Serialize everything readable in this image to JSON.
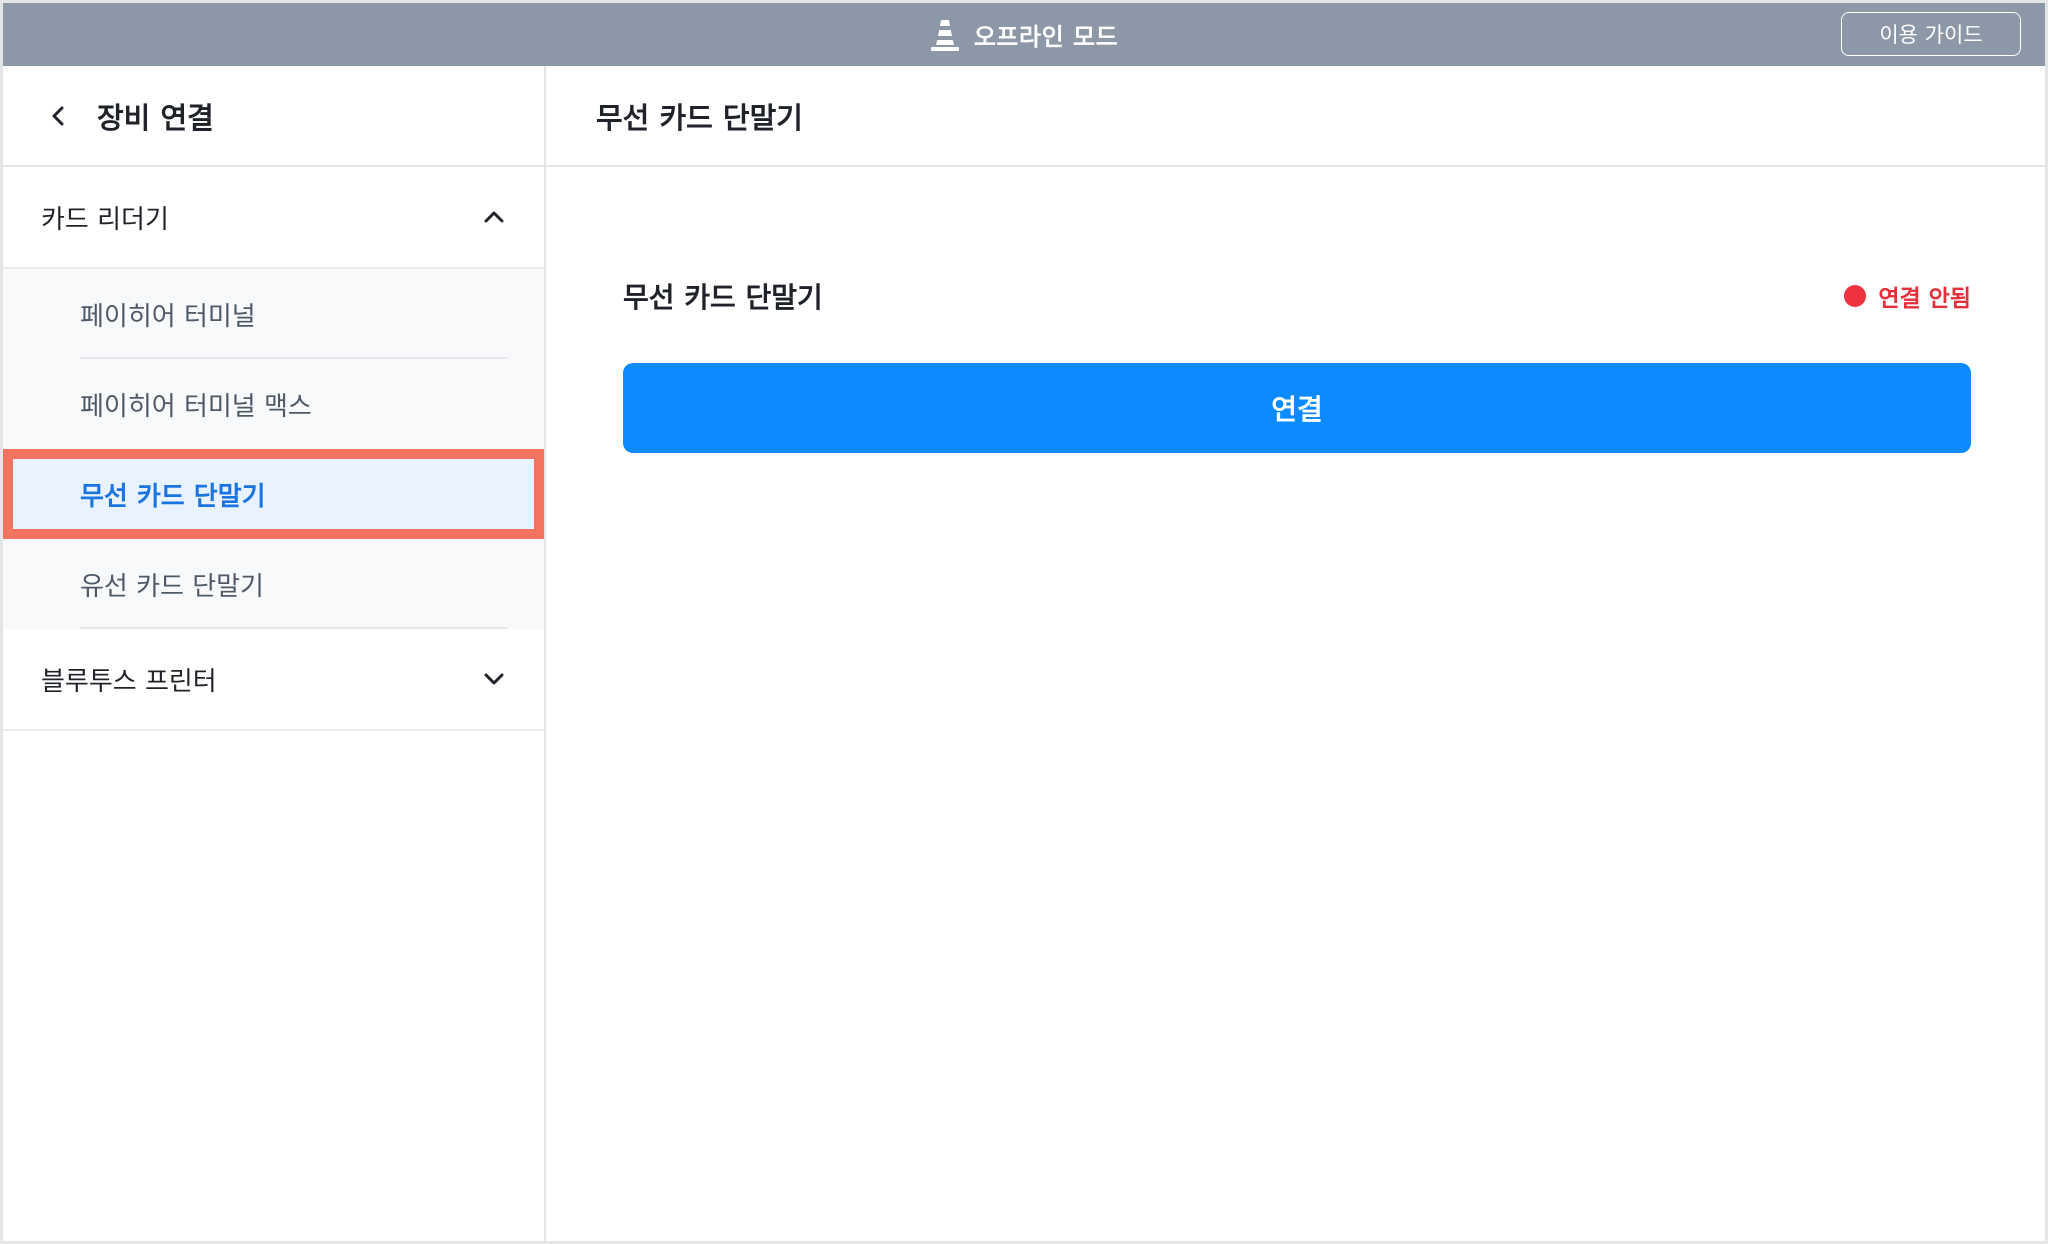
{
  "topbar": {
    "title": "오프라인 모드",
    "icon": "traffic-cone-icon",
    "guide_label": "이용 가이드",
    "background": "#8c97a7"
  },
  "sidebar": {
    "title": "장비 연결",
    "back_icon": "chevron-left-icon",
    "groups": [
      {
        "label": "카드 리더기",
        "expanded": true,
        "icon": "chevron-up-icon",
        "items": [
          {
            "label": "페이히어 터미널",
            "selected": false
          },
          {
            "label": "페이히어 터미널 맥스",
            "selected": false
          },
          {
            "label": "무선 카드 단말기",
            "selected": true
          },
          {
            "label": "유선 카드 단말기",
            "selected": false
          }
        ]
      },
      {
        "label": "블루투스 프린터",
        "expanded": false,
        "icon": "chevron-down-icon"
      }
    ]
  },
  "main": {
    "title": "무선 카드 단말기",
    "device_name": "무선 카드 단말기",
    "status": {
      "text": "연결 안됨",
      "color": "#f0323f"
    },
    "connect_label": "연결",
    "accent": "#0b8bff"
  }
}
